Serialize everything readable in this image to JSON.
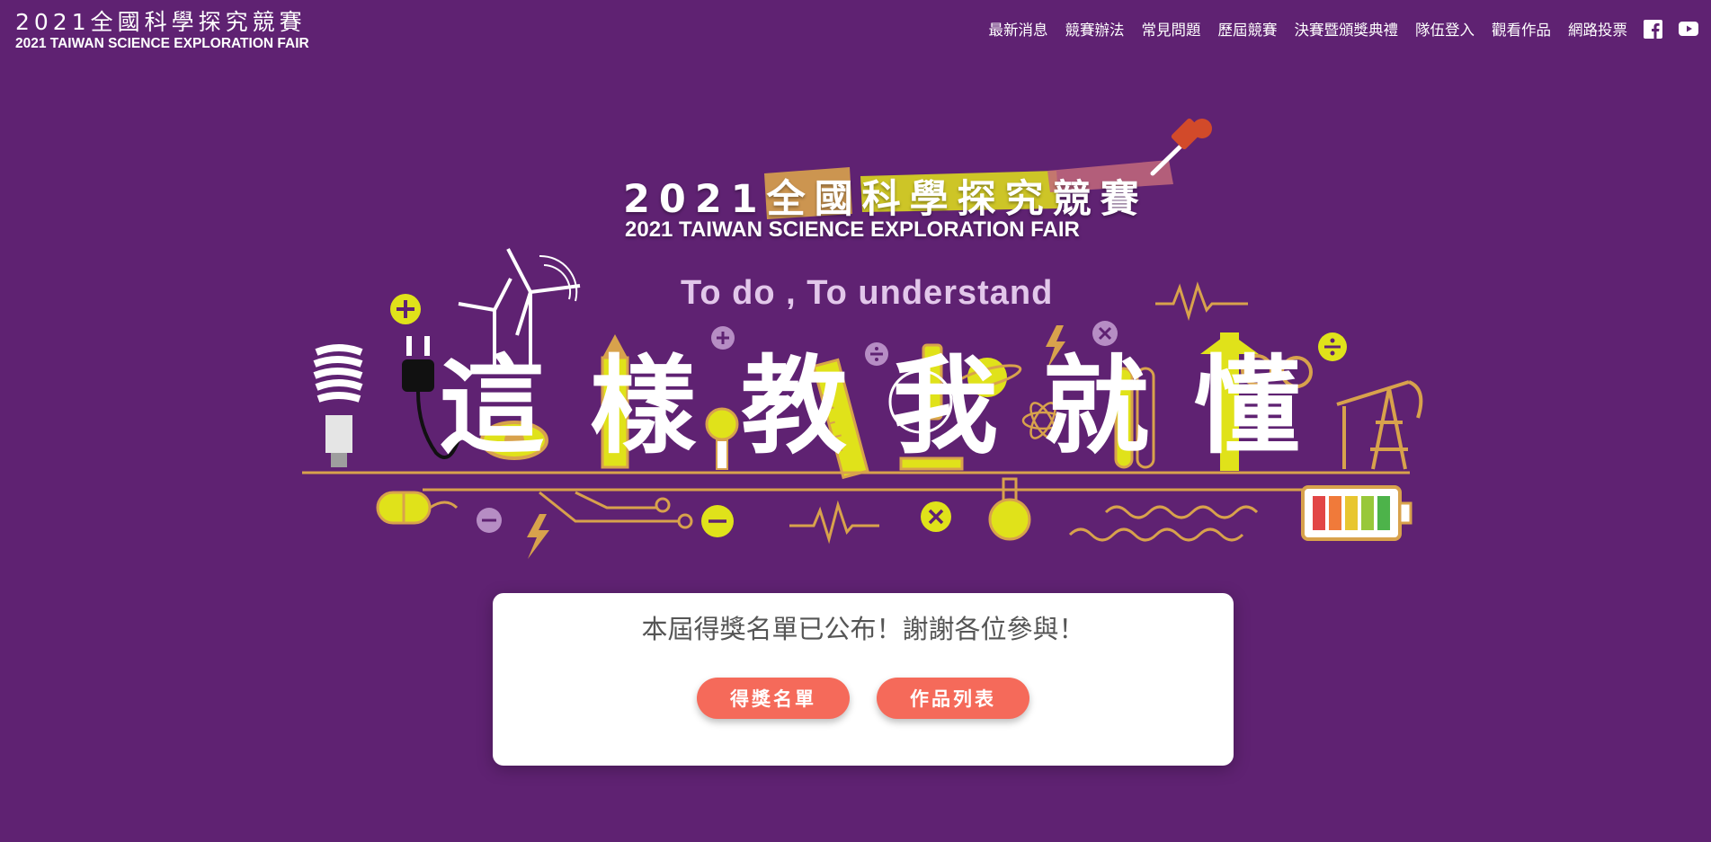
{
  "header": {
    "logo_cn": "2021全國科學探究競賽",
    "logo_en": "2021 TAIWAN SCIENCE EXPLORATION FAIR"
  },
  "nav": {
    "items": [
      {
        "label": "最新消息"
      },
      {
        "label": "競賽辦法"
      },
      {
        "label": "常見問題"
      },
      {
        "label": "歷屆競賽"
      },
      {
        "label": "決賽暨頒獎典禮"
      },
      {
        "label": "隊伍登入"
      },
      {
        "label": "觀看作品"
      },
      {
        "label": "網路投票"
      }
    ],
    "social": [
      "facebook-icon",
      "youtube-icon"
    ]
  },
  "hero": {
    "title_cn": "2021全國科學探究競賽",
    "title_en": "2021 TAIWAN SCIENCE EXPLORATION FAIR",
    "tagline": "To do , To understand",
    "chars": [
      "這",
      "樣",
      "教",
      "我",
      "就",
      "懂"
    ]
  },
  "announcement": {
    "message": "本屆得獎名單已公布！謝謝各位參與！",
    "buttons": [
      {
        "label": "得獎名單"
      },
      {
        "label": "作品列表"
      }
    ]
  },
  "colors": {
    "background": "#5f2272",
    "accent_yellow": "#e0e21a",
    "accent_gold": "#d8a24c",
    "button": "#f56a5a"
  }
}
